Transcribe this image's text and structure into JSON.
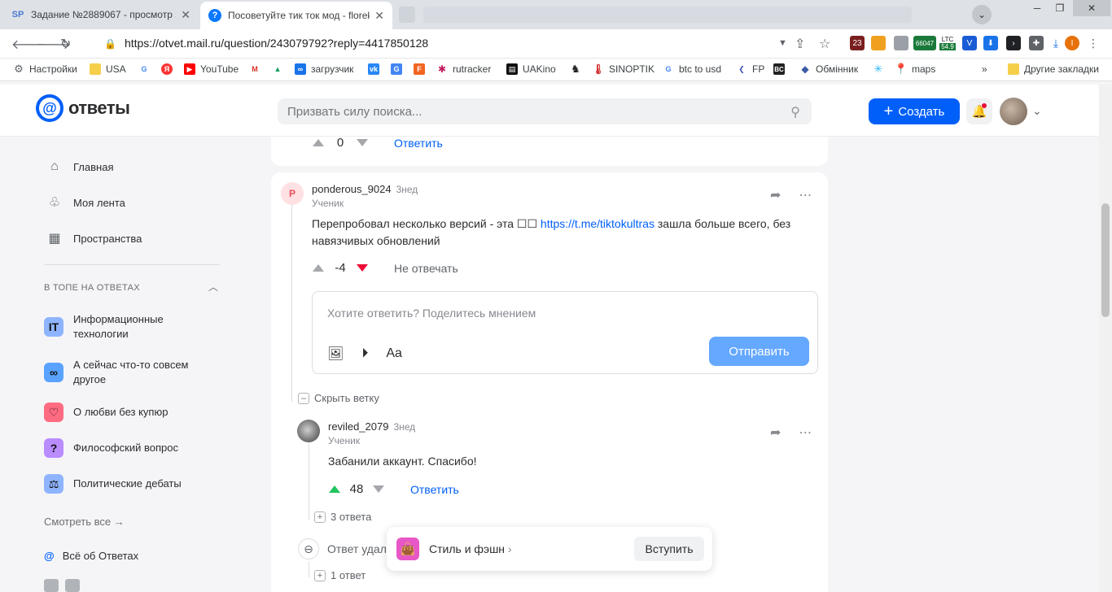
{
  "browser": {
    "tabs": [
      {
        "favicon": "SP",
        "title": "Задание №2889067 - просмотр з..."
      },
      {
        "favicon": "?",
        "title": "Посоветуйте тик ток мод - florek_"
      }
    ],
    "url": "https://otvet.mail.ru/question/243079792?reply=4417850128",
    "extension_badges": {
      "counter": "23",
      "btc": "66047",
      "ltc_label": "LTC",
      "ltc_value": "54.9"
    },
    "bookmarks": [
      {
        "label": "Настройки",
        "icon": "gear-icon"
      },
      {
        "label": "USA",
        "icon": "folder-icon"
      },
      {
        "label": "",
        "icon": "google-icon"
      },
      {
        "label": "",
        "icon": "yandex-icon"
      },
      {
        "label": "YouTube",
        "icon": "youtube-icon"
      },
      {
        "label": "",
        "icon": "gmail-icon"
      },
      {
        "label": "",
        "icon": "drive-icon"
      },
      {
        "label": "загрузчик",
        "icon": "link-icon"
      },
      {
        "label": "",
        "icon": "vk-icon"
      },
      {
        "label": "",
        "icon": "translate-icon"
      },
      {
        "label": "",
        "icon": "f-icon"
      },
      {
        "label": "rutracker",
        "icon": "rutracker-icon"
      },
      {
        "label": "UAKino",
        "icon": "uakino-icon"
      },
      {
        "label": "",
        "icon": "chess-icon"
      },
      {
        "label": "SINOPTIK",
        "icon": "thermometer-icon"
      },
      {
        "label": "btc to usd",
        "icon": "google-icon"
      },
      {
        "label": "FP",
        "icon": "fp-icon"
      },
      {
        "label": "",
        "icon": "bc-icon"
      },
      {
        "label": "Обмінник",
        "icon": "exchange-icon"
      },
      {
        "label": "",
        "icon": "snowflake-icon"
      },
      {
        "label": "maps",
        "icon": "maps-icon"
      }
    ],
    "other_bookmarks": "Другие закладки",
    "bookmarks_more": "»"
  },
  "header": {
    "logo_text": "ответы",
    "search_placeholder": "Призвать силу поиска...",
    "create_label": "Создать"
  },
  "sidebar": {
    "nav": [
      {
        "label": "Главная",
        "icon": "home-icon"
      },
      {
        "label": "Моя лента",
        "icon": "feed-icon"
      },
      {
        "label": "Пространства",
        "icon": "spaces-icon"
      }
    ],
    "section_title": "В ТОПЕ НА ОТВЕТАХ",
    "topics": [
      {
        "label": "Информационные технологии",
        "badge": "IT",
        "color": "#8fb4ff"
      },
      {
        "label": "А сейчас что-то совсем другое",
        "badge": "∞",
        "color": "#5aa2ff"
      },
      {
        "label": "О любви без купюр",
        "badge": "♡",
        "color": "#ff6b81"
      },
      {
        "label": "Философский вопрос",
        "badge": "?",
        "color": "#b98cff"
      },
      {
        "label": "Политические дебаты",
        "badge": "⚖",
        "color": "#8fb4ff"
      }
    ],
    "see_all": "Смотреть все →",
    "about": "Всё об Ответах"
  },
  "main": {
    "top_card": {
      "votes": "0",
      "reply": "Ответить"
    },
    "comment1": {
      "avatar_letter": "P",
      "username": "ponderous_9024",
      "ago": "3нед",
      "role": "Ученик",
      "text_before": "Перепробовал несколько версий - эта ☐☐ ",
      "link": "https://t.me/tiktokultras",
      "text_after": " зашла больше всего, без навязчивых обновлений",
      "votes": "-4",
      "action": "Не отвечать"
    },
    "reply_box": {
      "placeholder": "Хотите ответить? Поделитесь мнением",
      "format_label": "Aa",
      "send_label": "Отправить"
    },
    "hide_branch": "Скрыть ветку",
    "comment2": {
      "username": "reviled_2079",
      "ago": "3нед",
      "role": "Ученик",
      "text": "Забанили аккаунт. Спасибо!",
      "votes": "48",
      "action": "Ответить",
      "replies": "3 ответа"
    },
    "deleted": {
      "text": "Ответ удал",
      "replies": "1 ответ"
    },
    "popup": {
      "title": "Стиль и фэшн",
      "join_label": "Вступить"
    }
  },
  "colors": {
    "accent": "#005ff9",
    "upvote": "#21c45d",
    "downvote": "#ed0a34"
  }
}
